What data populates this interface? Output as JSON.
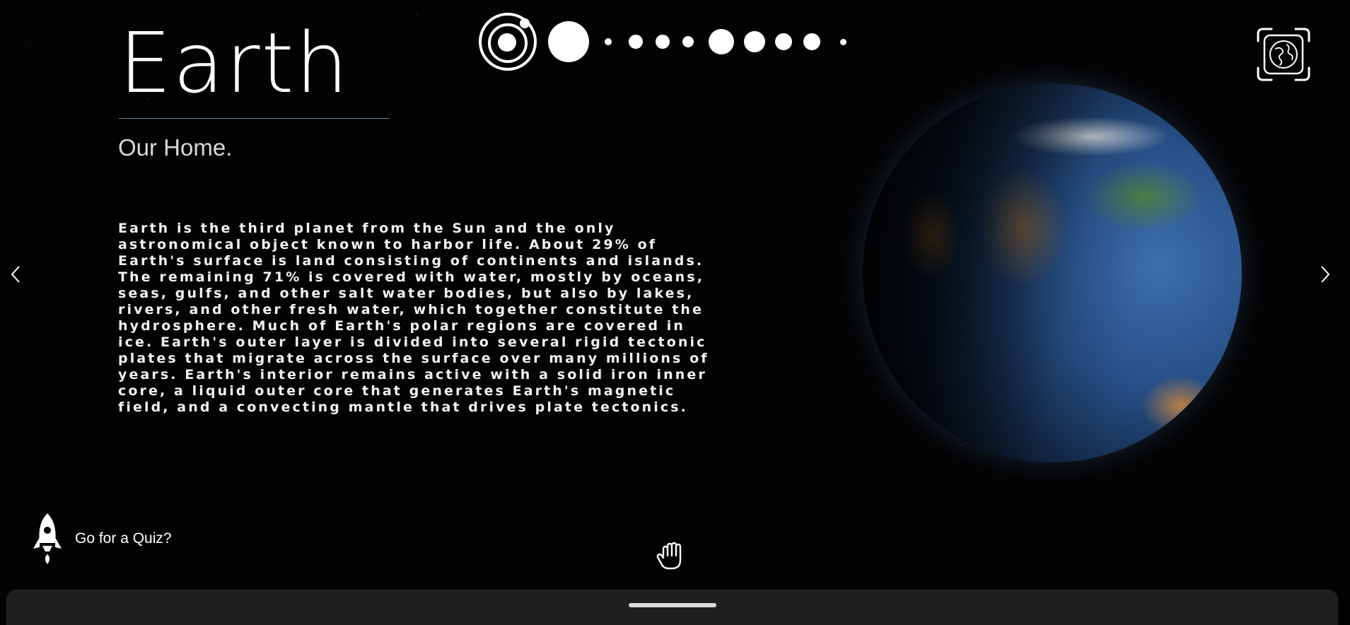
{
  "planet": {
    "title": "Earth",
    "subtitle": "Our Home.",
    "description": "Earth is the third planet from the Sun and the only astronomical object known to harbor life. About 29% of Earth's surface is land consisting of continents and islands. The remaining 71% is covered with water, mostly by oceans, seas, gulfs, and other salt water bodies, but also by lakes, rivers, and other fresh water, which together constitute the hydrosphere. Much of Earth's polar regions are covered in ice. Earth's outer layer is divided into several rigid tectonic plates that migrate across the surface over many millions of years. Earth's interior remains active with a solid iron inner core, a liquid outer core that generates Earth's magnetic field, and a convecting mantle that drives plate tectonics."
  },
  "nav": {
    "solar_system_icon": "solar-system-icon",
    "planet_dots": [
      "sun",
      "mercury",
      "venus",
      "earth",
      "mars",
      "jupiter",
      "saturn",
      "uranus",
      "neptune",
      "pluto"
    ]
  },
  "quiz": {
    "label": "Go for a Quiz?",
    "icon": "rocket-icon"
  },
  "icons": {
    "globe": "globe-frame-icon",
    "prev": "chevron-left-icon",
    "next": "chevron-right-icon",
    "hand": "hand-icon"
  },
  "colors": {
    "background": "#030303",
    "text": "#ffffff",
    "accent_rule": "#8aa8c0",
    "sheet": "#202022"
  }
}
